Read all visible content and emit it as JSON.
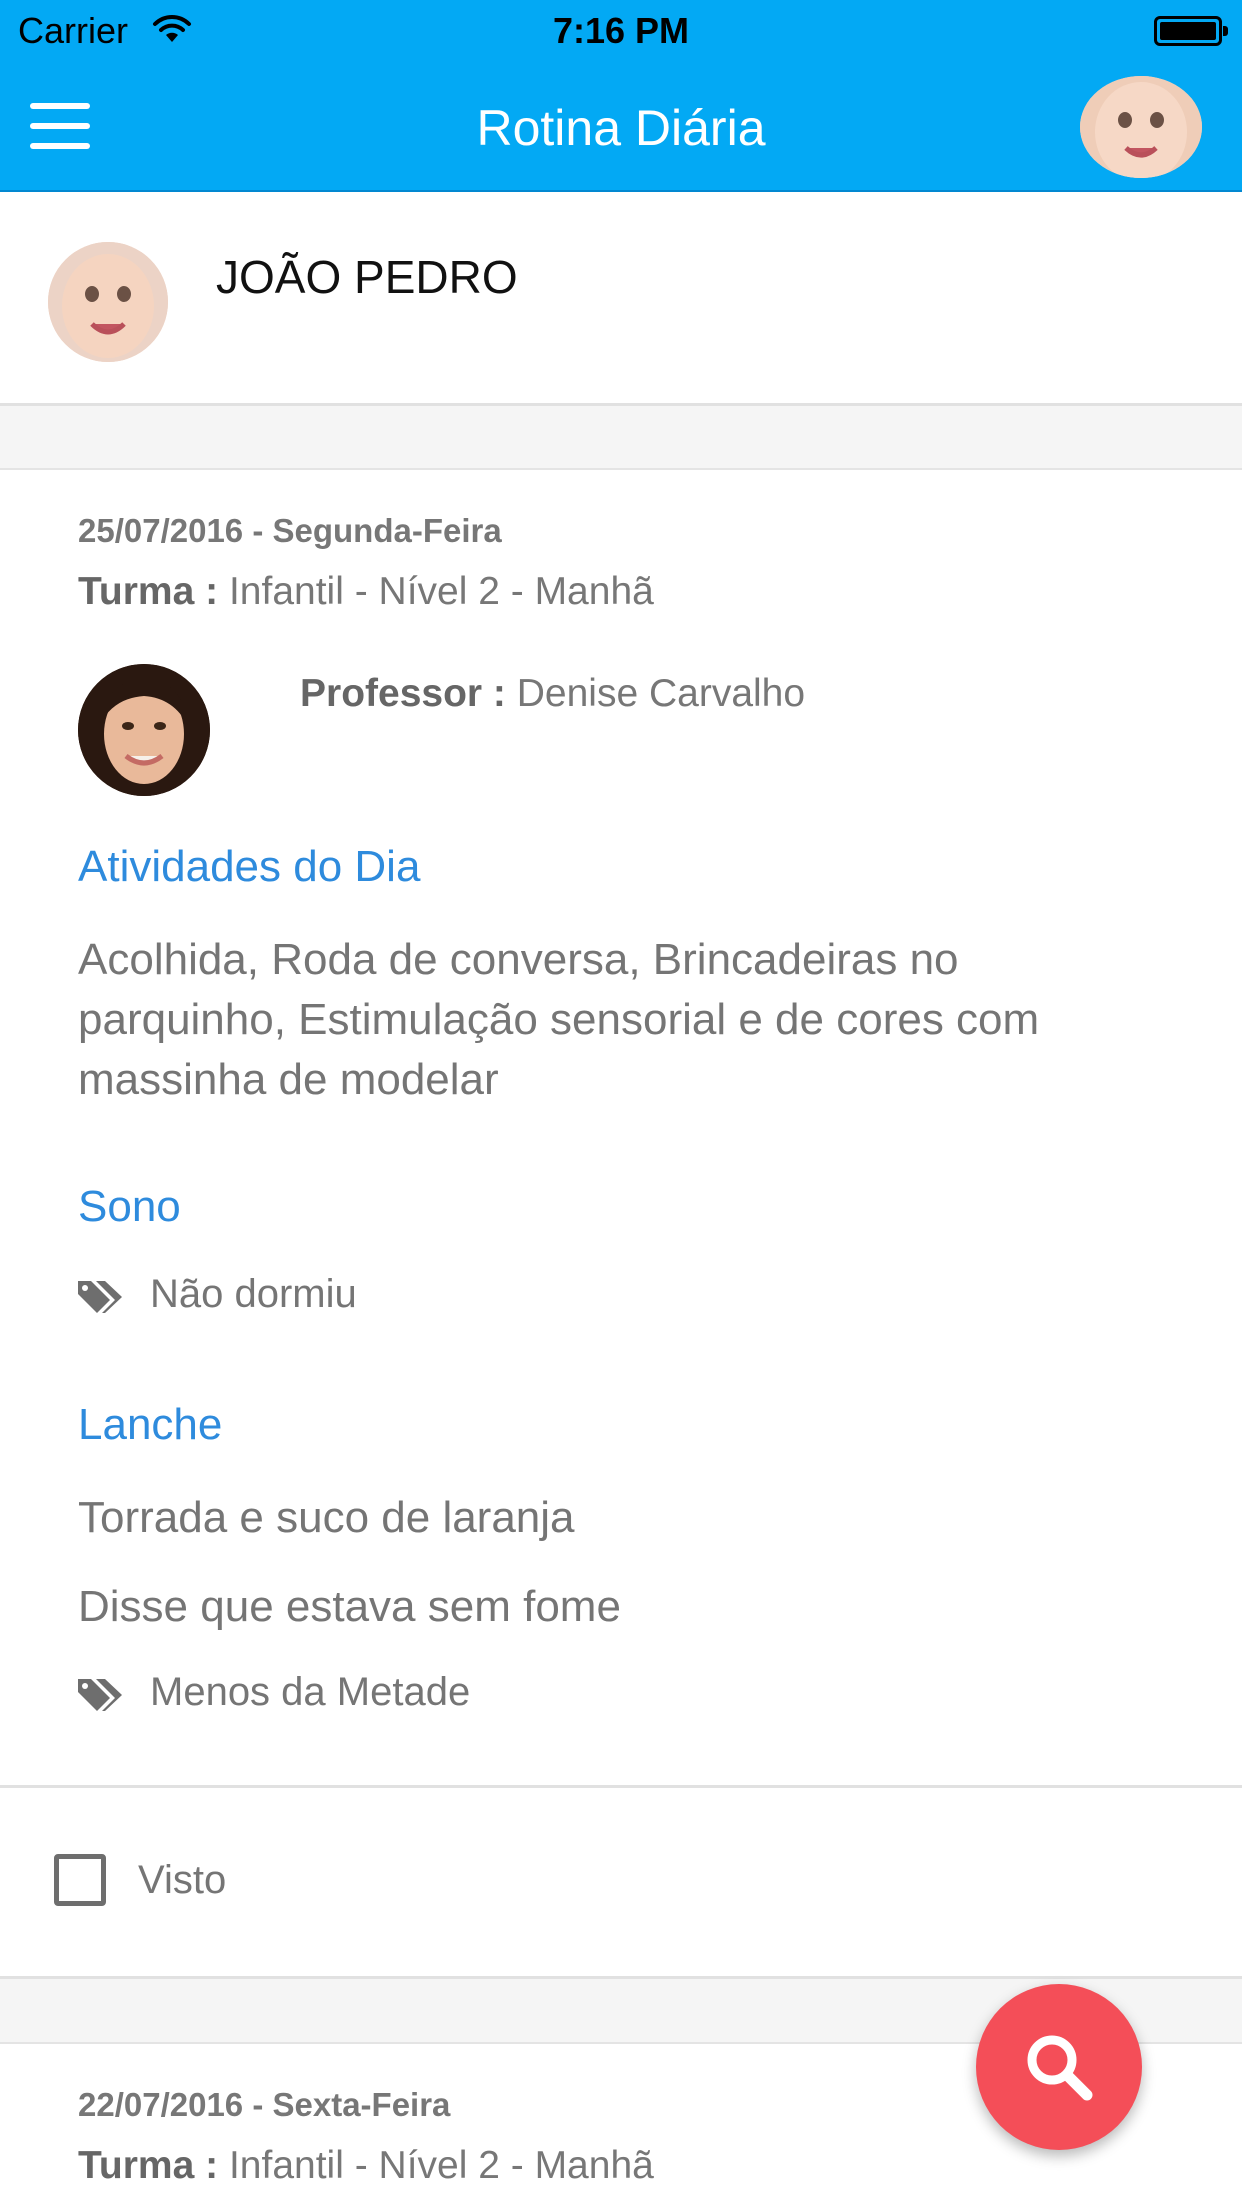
{
  "status_bar": {
    "carrier": "Carrier",
    "time": "7:16 PM",
    "icons": [
      "wifi-icon",
      "battery-icon"
    ]
  },
  "header": {
    "title": "Rotina Diária",
    "menu_icon": "hamburger-menu-icon",
    "avatar_icon": "baby-avatar",
    "background_color": "#03A9F4"
  },
  "student": {
    "name": "JOÃO PEDRO"
  },
  "entries": [
    {
      "date": "25/07/2016 - Segunda-Feira",
      "turma_label": "Turma :",
      "turma_value": "Infantil - Nível 2 - Manhã",
      "professor_label": "Professor :",
      "professor_value": "Denise Carvalho",
      "activities_title": "Atividades do Dia",
      "activities_text": "Acolhida, Roda de conversa, Brincadeiras no parquinho, Estimulação sensorial e de cores com massinha de modelar",
      "sleep_title": "Sono",
      "sleep_tag": "Não dormiu",
      "snack_title": "Lanche",
      "snack_text": "Torrada e suco de laranja",
      "snack_note": "Disse que estava sem fome",
      "snack_tag": "Menos da Metade",
      "seen_label": "Visto",
      "seen_checked": false
    },
    {
      "date": "22/07/2016 - Sexta-Feira",
      "turma_label": "Turma :",
      "turma_value": "Infantil - Nível 2 - Manhã"
    }
  ],
  "fab": {
    "icon": "search-icon",
    "color": "#F44E58"
  },
  "colors": {
    "accent": "#03A9F4",
    "section_title": "#2E8BDD",
    "text": "#757575"
  }
}
